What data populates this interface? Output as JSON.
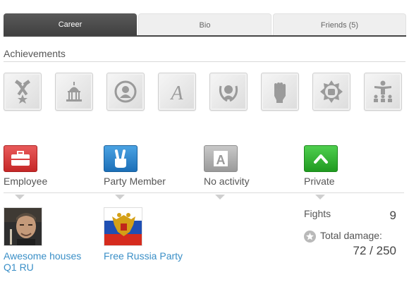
{
  "tabs": [
    {
      "label": "Career",
      "active": true
    },
    {
      "label": "Bio",
      "active": false
    },
    {
      "label": "Friends (5)",
      "active": false
    }
  ],
  "achievements": {
    "title": "Achievements",
    "icons": [
      "hammer-pickaxe-star-icon",
      "capitol-icon",
      "portrait-medal-icon",
      "letter-a-icon",
      "laurel-wreath-head-icon",
      "raised-fist-icon",
      "fist-burst-icon",
      "speaker-audience-icon"
    ]
  },
  "statuses": [
    {
      "label": "Employee",
      "icon": "briefcase-icon",
      "color": "#d93a3a"
    },
    {
      "label": "Party Member",
      "icon": "victory-hand-icon",
      "color": "#2a86cc"
    },
    {
      "label": "No activity",
      "icon": "army-a-icon",
      "color": "#aaaaaa"
    },
    {
      "label": "Private",
      "icon": "chevron-up-icon",
      "color": "#2fb12f"
    }
  ],
  "employer": {
    "name": "Awesome houses Q1 RU",
    "line1": "Awesome houses",
    "line2": "Q1 RU"
  },
  "party": {
    "name": "Free Russia Party"
  },
  "stats": {
    "fights_label": "Fights",
    "fights_value": "9",
    "damage_label": "Total damage:",
    "damage_value": "72 / 250"
  }
}
